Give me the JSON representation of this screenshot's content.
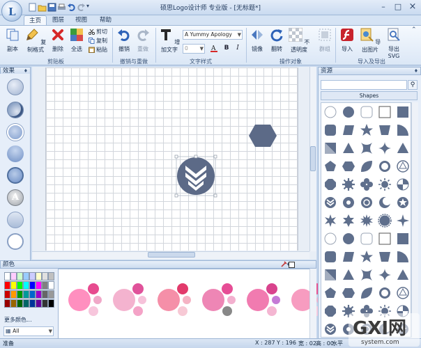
{
  "window": {
    "title": "硕思Logo设计师  专业版 - [无标题*]",
    "controls": [
      "–",
      "□",
      "×"
    ]
  },
  "tabs": [
    {
      "label": "主页",
      "active": true
    },
    {
      "label": "图层",
      "active": false
    },
    {
      "label": "视图",
      "active": false
    },
    {
      "label": "帮助",
      "active": false
    }
  ],
  "ribbon": {
    "clipboard": {
      "group_label": "剪贴板",
      "copy_label": "副本",
      "format_copy_label": "复制格式",
      "delete_label": "删除",
      "select_all_label": "全选",
      "cut_label": "剪切",
      "duplicate_label": "复制",
      "paste_label": "粘贴"
    },
    "undo_redo": {
      "group_label": "撤销与重做",
      "undo_label": "撤销",
      "redo_label": "重做"
    },
    "text_style": {
      "group_label": "文字样式",
      "add_text_label": "增加文字",
      "font_value": "A Yummy Apology",
      "size_value": "0",
      "bold_glyph": "B",
      "italic_glyph": "I"
    },
    "operate": {
      "group_label": "操作对象",
      "mirror_label": "镜像",
      "flip_label": "翻转",
      "opacity_label": "不透明度",
      "group_obj_label": "群组"
    },
    "import_export": {
      "group_label": "导入及导出",
      "import_label": "导入",
      "export_image_label": "导出图片",
      "export_svg_label": "导出SVG"
    }
  },
  "effects_panel": {
    "title": "效果",
    "pin": "♦"
  },
  "colors_panel": {
    "title": "颜色",
    "more_colors": "更多颜色...",
    "palette_value": "All",
    "swatches": [
      "#ffffff",
      "#ffccff",
      "#ccffcc",
      "#99ccff",
      "#ccccff",
      "#ffffcc",
      "#e0e0e0",
      "#c0c0c0",
      "#ff0000",
      "#ffff00",
      "#00ff00",
      "#00ffff",
      "#0000ff",
      "#ff00ff",
      "#808080",
      "#ffffff",
      "#cc0000",
      "#ff9900",
      "#009900",
      "#009999",
      "#0066cc",
      "#9900cc",
      "#666666",
      "#999999",
      "#990000",
      "#996600",
      "#006600",
      "#006666",
      "#003399",
      "#660099",
      "#333333",
      "#000000"
    ],
    "palettes": [
      [
        "#ff8fbf",
        "#e74b8f",
        "#f0a8c8",
        "#f7c6dc"
      ],
      [
        "#f4b3cf",
        "#e0529a",
        "#f6c2da",
        "#f4a3c7"
      ],
      [
        "#f58fa8",
        "#e23a6b",
        "#f5b3c4",
        "#f7c9d5"
      ],
      [
        "#ee86b5",
        "#e64d95",
        "#f3b0cf",
        "#888888"
      ],
      [
        "#f17bb0",
        "#d9438d",
        "#c57ad6",
        "#f4b6d2"
      ],
      [
        "#f79cc0",
        "#ea5593",
        "#f4b4cf",
        "#f8cde0"
      ]
    ]
  },
  "resources_panel": {
    "title": "资源",
    "search_placeholder": "",
    "category": "Shapes",
    "accent": "#5f6f8c"
  },
  "canvas": {
    "shape_color": "#5c6a87"
  },
  "status": {
    "ready": "准备",
    "x": "X : 287",
    "y": "Y : 196",
    "w": "宽 : 02",
    "h": "高 : 00",
    "more": "水平"
  },
  "watermark": {
    "text": "GXI网",
    "sub": "system.com"
  }
}
